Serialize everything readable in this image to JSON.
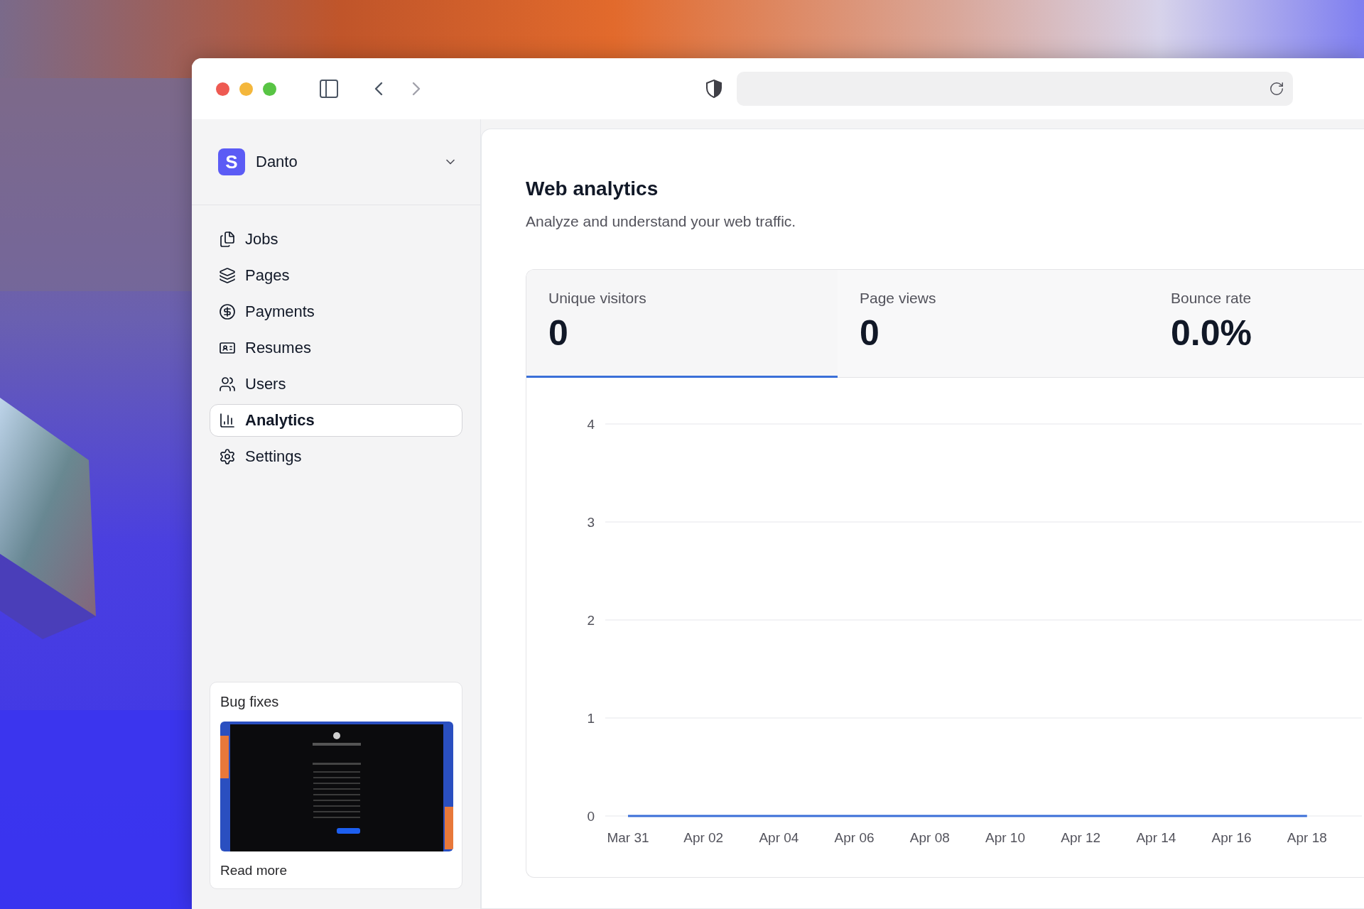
{
  "sidebar": {
    "org": {
      "logo_letter": "S",
      "name": "Danto"
    },
    "nav": [
      {
        "label": "Jobs",
        "selected": false
      },
      {
        "label": "Pages",
        "selected": false
      },
      {
        "label": "Payments",
        "selected": false
      },
      {
        "label": "Resumes",
        "selected": false
      },
      {
        "label": "Users",
        "selected": false
      },
      {
        "label": "Analytics",
        "selected": true
      },
      {
        "label": "Settings",
        "selected": false
      }
    ],
    "news_card": {
      "title": "Bug fixes",
      "link": "Read more"
    }
  },
  "main": {
    "title": "Web analytics",
    "subtitle": "Analyze and understand your web traffic.",
    "stats": [
      {
        "label": "Unique visitors",
        "value": "0",
        "selected": true
      },
      {
        "label": "Page views",
        "value": "0",
        "selected": false
      },
      {
        "label": "Bounce rate",
        "value": "0.0%",
        "selected": false
      }
    ],
    "chart_data": {
      "type": "line",
      "categories": [
        "Mar 31",
        "Apr 02",
        "Apr 04",
        "Apr 06",
        "Apr 08",
        "Apr 10",
        "Apr 12",
        "Apr 14",
        "Apr 16",
        "Apr 18"
      ],
      "series": [
        {
          "color": "#3a6fd8",
          "values": [
            0,
            0,
            0,
            0,
            0,
            0,
            0,
            0,
            0,
            0
          ]
        }
      ],
      "ylim": [
        0,
        4
      ],
      "yticks": [
        0,
        1,
        2,
        3,
        4
      ],
      "grid": true
    }
  }
}
